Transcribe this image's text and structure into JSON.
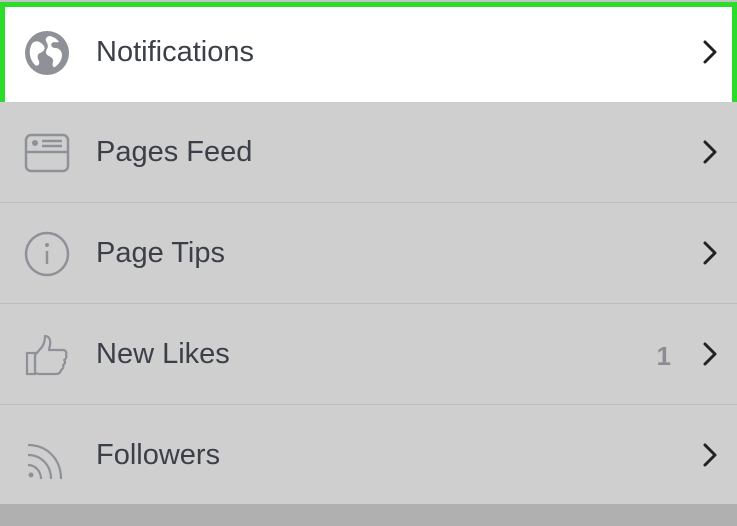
{
  "menu": {
    "items": [
      {
        "label": "Notifications",
        "icon": "globe-icon",
        "highlighted": true
      },
      {
        "label": "Pages Feed",
        "icon": "feed-icon",
        "highlighted": false
      },
      {
        "label": "Page Tips",
        "icon": "info-icon",
        "highlighted": false
      },
      {
        "label": "New Likes",
        "icon": "thumbs-up-icon",
        "count": "1",
        "highlighted": false
      },
      {
        "label": "Followers",
        "icon": "rss-icon",
        "highlighted": false
      }
    ]
  },
  "colors": {
    "highlight_border": "#2bdc2b",
    "row_background": "#cfcfcf",
    "highlight_background": "#ffffff",
    "text": "#3b3f48",
    "count": "#8a8d92"
  }
}
